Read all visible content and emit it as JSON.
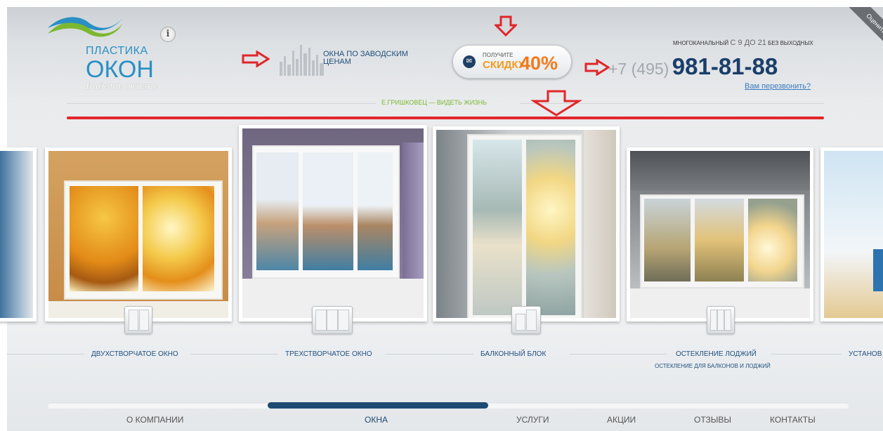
{
  "logo": {
    "line1": "ПЛАСТИКА",
    "line2": "ОКОН",
    "tagline": "Видеть жизнь",
    "info_glyph": "i"
  },
  "header": {
    "factory_price": "ОКНА ПО ЗАВОДСКИМ ЦЕНАМ",
    "discount": {
      "small": "ПОЛУЧИТЕ",
      "big": "СКИДКУ",
      "percent": "40%"
    },
    "hours_prefix": "МНОГОКАНАЛЬНЫЙ",
    "hours_main": "С 9 ДО 21",
    "hours_suffix": "БЕЗ ВЫХОДНЫХ",
    "phone_code": "+7 (495)",
    "phone_number": "981-81-88",
    "callback": "Вам перезвонить?",
    "rate_site": "Оценить сайт",
    "slogan": "Е.ГРИШКОВЕЦ — ВИДЕТЬ ЖИЗНЬ"
  },
  "carousel": {
    "items": [
      {
        "label": "ДВУХСТВОРЧАТОЕ ОКНО",
        "sub": ""
      },
      {
        "label": "ТРЕХСТВОРЧАТОЕ ОКНО",
        "sub": ""
      },
      {
        "label": "БАЛКОННЫЙ БЛОК",
        "sub": ""
      },
      {
        "label": "ОСТЕКЛЕНИЕ ЛОДЖИЙ",
        "sub": "ОСТЕКЛЕНИЕ ДЛЯ БАЛКОНОВ И ЛОДЖИЙ"
      },
      {
        "label": "УСТАНОВ",
        "sub": ""
      }
    ]
  },
  "nav": {
    "items": [
      "О КОМПАНИИ",
      "ОКНА",
      "УСЛУГИ",
      "АКЦИИ",
      "ОТЗЫВЫ",
      "КОНТАКТЫ"
    ],
    "active": "ОКНА"
  },
  "colors": {
    "annotation_red": "#e0262a",
    "brand_blue": "#1a3e6a",
    "accent_orange": "#f27a1e",
    "slogan_green": "#7cb82f"
  },
  "icons": [
    "info-icon",
    "skyline-icon",
    "envelope-icon",
    "red-arrow-icon",
    "window-2-icon",
    "window-3-icon",
    "door-icon",
    "loggia-icon"
  ]
}
